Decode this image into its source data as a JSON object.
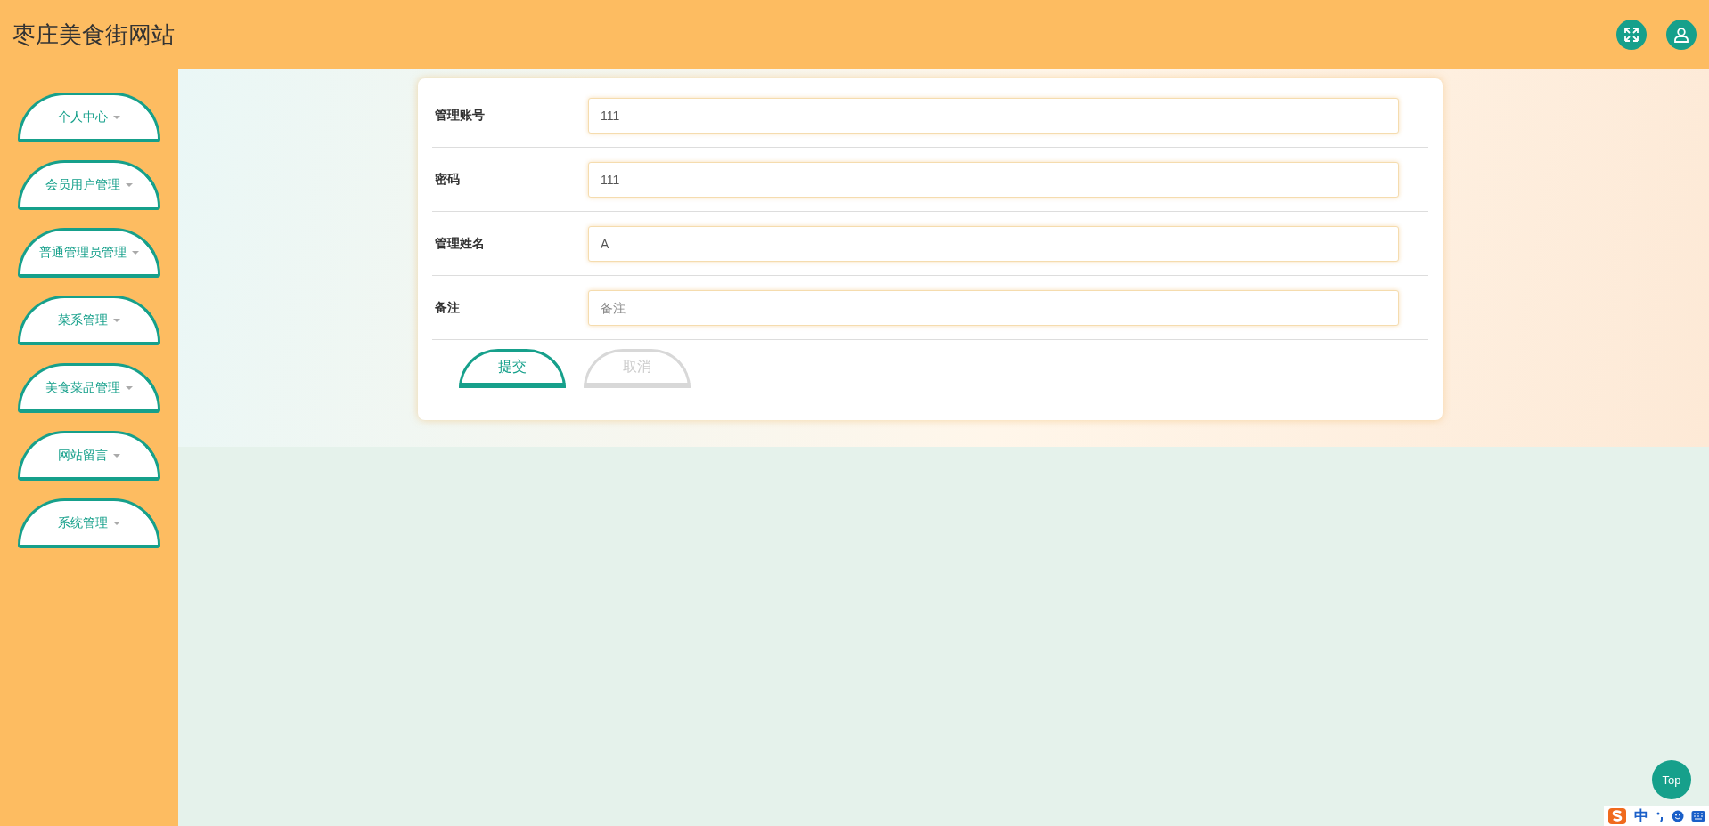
{
  "header": {
    "title": "枣庄美食街网站"
  },
  "sidebar": {
    "items": [
      {
        "label": "个人中心"
      },
      {
        "label": "会员用户管理"
      },
      {
        "label": "普通管理员管理"
      },
      {
        "label": "菜系管理"
      },
      {
        "label": "美食菜品管理"
      },
      {
        "label": "网站留言"
      },
      {
        "label": "系统管理"
      }
    ]
  },
  "form": {
    "fields": [
      {
        "label": "管理账号",
        "value": "111"
      },
      {
        "label": "密码",
        "value": "111"
      },
      {
        "label": "管理姓名",
        "value": "A"
      },
      {
        "label": "备注",
        "placeholder": "备注"
      }
    ],
    "buttons": [
      {
        "label": "提交",
        "kind": "primary"
      },
      {
        "label": "取消",
        "kind": "secondary"
      }
    ]
  },
  "top_button": {
    "label": "Top"
  },
  "ime_bar": {
    "mode": "中"
  }
}
